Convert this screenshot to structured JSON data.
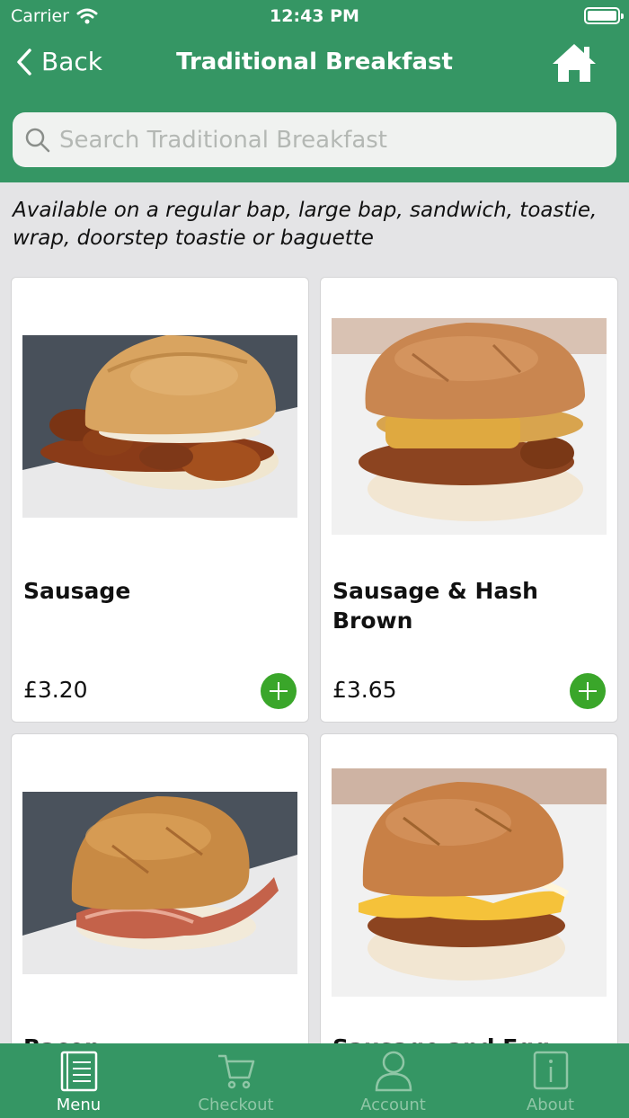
{
  "status_bar": {
    "carrier": "Carrier",
    "time": "12:43 PM"
  },
  "nav": {
    "back_label": "Back",
    "title": "Traditional Breakfast"
  },
  "search": {
    "placeholder": "Search Traditional Breakfast"
  },
  "note": "Available on a regular bap, large bap, sandwich, toastie, wrap, doorstep toastie or baguette",
  "products": [
    {
      "name": "Sausage",
      "price": "£3.20",
      "photo": "sausage-bap-photo"
    },
    {
      "name": "Sausage & Hash Brown",
      "price": "£3.65",
      "photo": "sausage-hash-brown-bap-photo"
    },
    {
      "name": "Bacon",
      "price": "",
      "photo": "bacon-bap-photo"
    },
    {
      "name": "Sausage and Egg",
      "price": "",
      "photo": "sausage-egg-bap-photo"
    }
  ],
  "tabs": [
    {
      "label": "Menu",
      "icon": "menu-icon",
      "active": true
    },
    {
      "label": "Checkout",
      "icon": "cart-icon",
      "active": false
    },
    {
      "label": "Account",
      "icon": "user-icon",
      "active": false
    },
    {
      "label": "About",
      "icon": "info-icon",
      "active": false
    }
  ],
  "colors": {
    "brand_green": "#359664",
    "add_button": "#3aa62a",
    "inactive_tab": "#8fc6a6"
  }
}
